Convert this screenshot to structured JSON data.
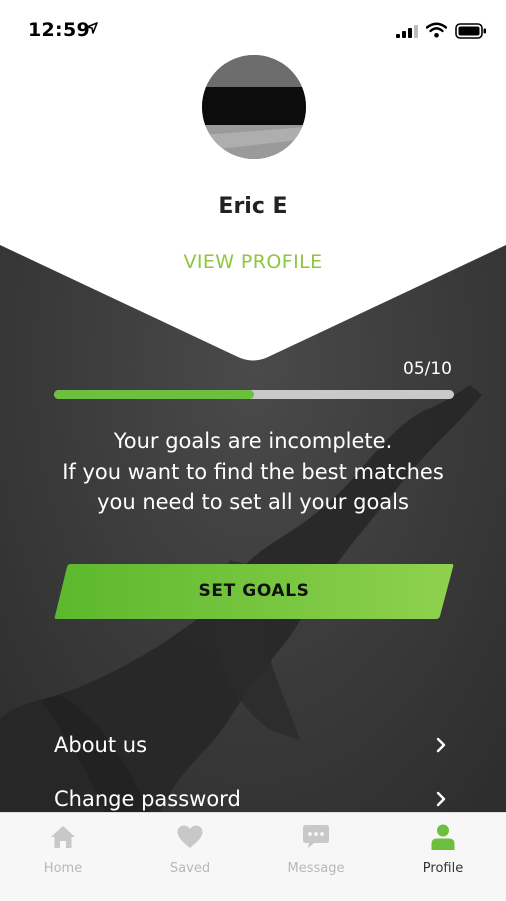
{
  "status_bar": {
    "time": "12:59"
  },
  "profile": {
    "name": "Eric E",
    "view_profile_label": "VIEW PROFILE"
  },
  "goals": {
    "progress_text": "05/10",
    "progress_fraction": 0.5,
    "message_lines": [
      "Your goals are incomplete.",
      "If you want to find the best matches",
      "you need to set all your goals"
    ],
    "button_label": "SET GOALS"
  },
  "menu": {
    "items": [
      {
        "label": "About us"
      },
      {
        "label": "Change password"
      }
    ]
  },
  "tabbar": {
    "tabs": [
      {
        "label": "Home",
        "icon": "home-icon",
        "active": false
      },
      {
        "label": "Saved",
        "icon": "heart-icon",
        "active": false
      },
      {
        "label": "Message",
        "icon": "chat-bubble-icon",
        "active": false
      },
      {
        "label": "Profile",
        "icon": "person-icon",
        "active": true
      }
    ]
  },
  "colors": {
    "accent": "#8dc63f",
    "progress": "#6cbf3f",
    "background": "#3a3a3a"
  }
}
